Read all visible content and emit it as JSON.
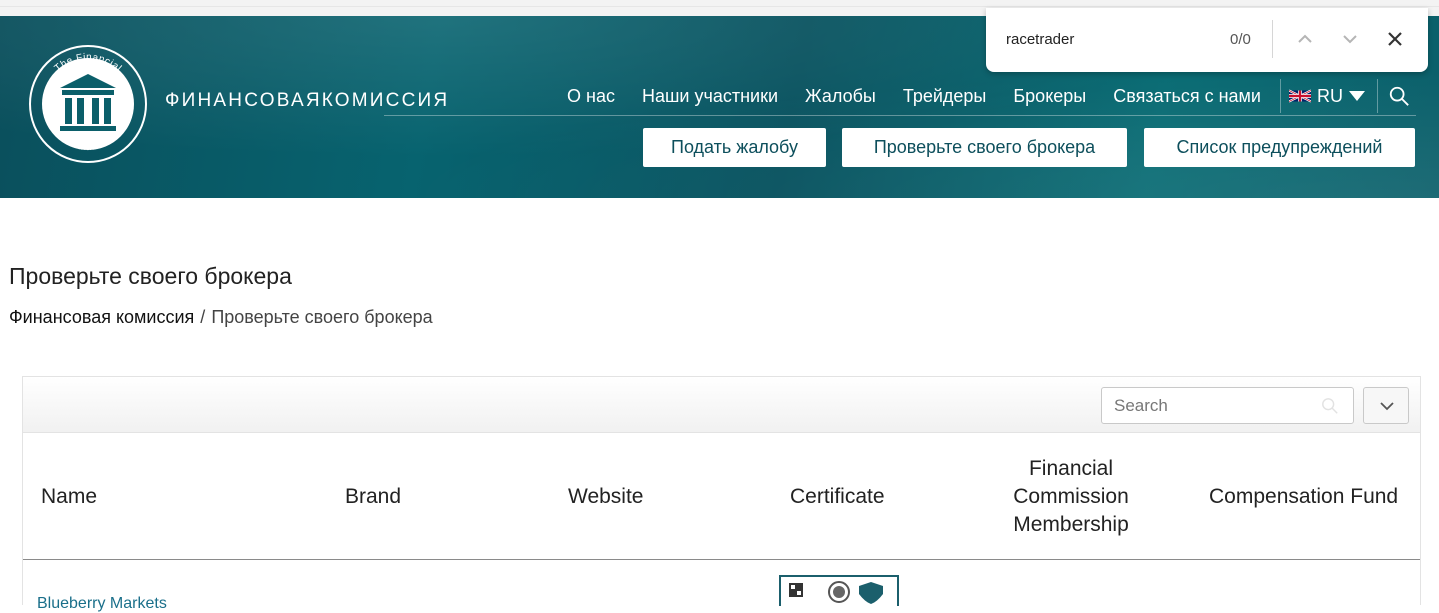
{
  "find_bar": {
    "query": "racetrader",
    "count": "0/0"
  },
  "header": {
    "logo_text_top": "The Financial",
    "logo_text_bottom": "Commission",
    "brand": "ФИНАНСОВАЯКОМИССИЯ",
    "nav": [
      "О нас",
      "Наши участники",
      "Жалобы",
      "Трейдеры",
      "Брокеры",
      "Связаться с нами"
    ],
    "language": "RU",
    "buttons": {
      "complaint": "Подать жалобу",
      "check_broker": "Проверьте своего брокера",
      "warnings": "Список предупреждений"
    }
  },
  "page": {
    "title": "Проверьте своего брокера",
    "breadcrumb": {
      "home": "Финансовая комиссия",
      "separator": "/",
      "current": "Проверьте своего брокера"
    }
  },
  "table": {
    "search_placeholder": "Search",
    "columns": {
      "name": "Name",
      "brand": "Brand",
      "website": "Website",
      "certificate": "Certificate",
      "membership_1": "Financial",
      "membership_2": "Commission",
      "membership_3": "Membership",
      "fund": "Compensation Fund"
    },
    "rows": [
      {
        "name": "Blueberry Markets"
      }
    ]
  },
  "colors": {
    "header": "#07636f",
    "button_text": "#0d4f5c",
    "link": "#1a6f8a"
  }
}
